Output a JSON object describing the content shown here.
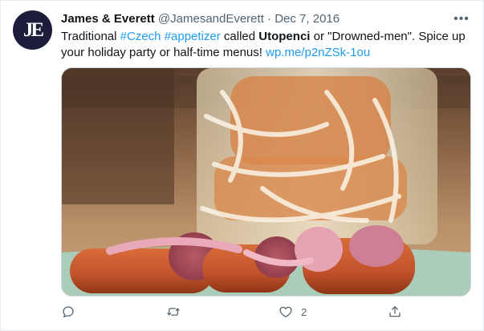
{
  "tweet": {
    "avatar_initials": "JE",
    "name": "James & Everett",
    "handle": "@JamesandEverett",
    "separator": "·",
    "date": "Dec 7, 2016",
    "more_icon": "more-horizontal-icon",
    "text": {
      "prefix": "Traditional ",
      "tag1": "#Czech",
      "space1": " ",
      "tag2": "#appetizer",
      "middle": " called ",
      "bold": "Utopenci",
      "rest": " or \"Drowned-men\". Spice up your holiday party or half-time menus!  ",
      "link": "wp.me/p2nZSk-1ou"
    },
    "actions": {
      "reply_icon": "reply-icon",
      "retweet_icon": "retweet-icon",
      "like_icon": "heart-icon",
      "like_count": "2",
      "share_icon": "share-icon"
    }
  },
  "colors": {
    "accent": "#1d9bf0",
    "text_primary": "#0f1419",
    "text_secondary": "#536471",
    "avatar_bg": "#1c1d3a"
  }
}
